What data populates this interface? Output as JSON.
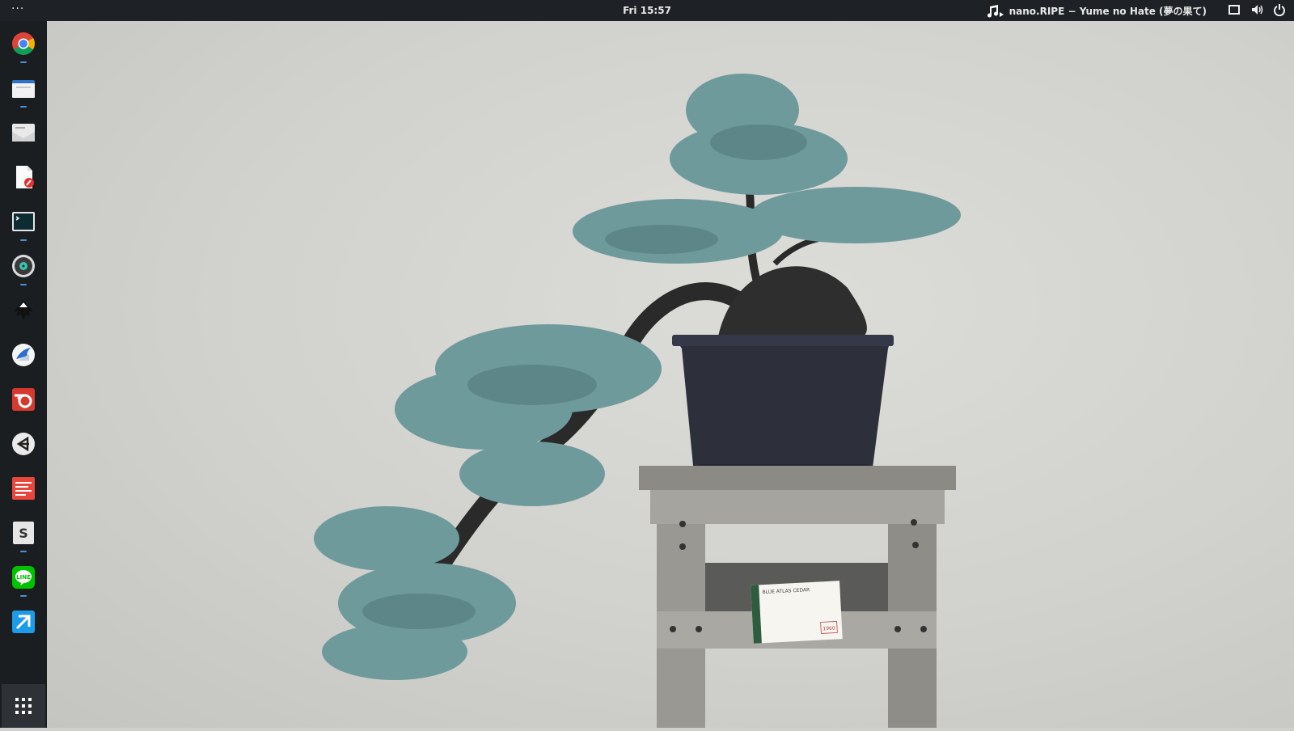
{
  "topbar": {
    "activities": "···",
    "clock": "Fri 15:57",
    "now_playing": "nano.RIPE − Yume no Hate (夢の果て)"
  },
  "dock": {
    "apps": [
      {
        "icon": "chrome-icon",
        "running": true
      },
      {
        "icon": "files-icon",
        "running": true
      },
      {
        "icon": "mail-icon",
        "running": false
      },
      {
        "icon": "text-editor-icon",
        "running": false
      },
      {
        "icon": "terminal-icon",
        "running": true
      },
      {
        "icon": "music-player-icon",
        "running": true
      },
      {
        "icon": "inkscape-icon",
        "running": false
      },
      {
        "icon": "thunderbird-icon",
        "running": false
      },
      {
        "icon": "blender-icon",
        "running": false
      },
      {
        "icon": "unity-icon",
        "running": false
      },
      {
        "icon": "notes-icon",
        "running": false
      },
      {
        "icon": "sublime-text-icon",
        "running": true
      },
      {
        "icon": "line-icon",
        "running": true
      },
      {
        "icon": "launcher-icon",
        "running": false
      }
    ],
    "show_apps_icon": "app-grid-icon"
  },
  "wallpaper": {
    "label_title": "BLUE ATLAS CEDAR",
    "label_year": "1960",
    "colors": {
      "wall": "#d2d2ce",
      "foliage": "#6f9a9c",
      "pot": "#2d2f3a",
      "stand": "#8c8a84"
    }
  }
}
